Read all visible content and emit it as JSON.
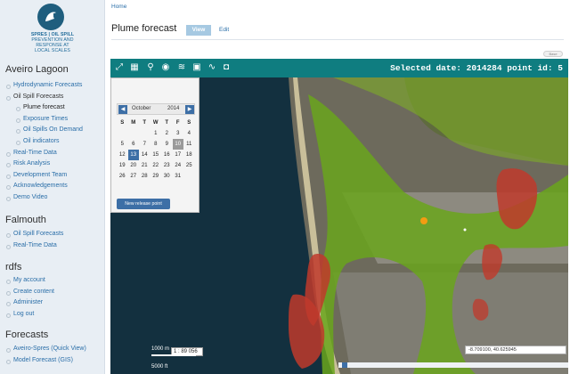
{
  "logo": {
    "line1": "SPRES | OIL SPILL",
    "line2": "PREVENTION AND",
    "line3": "RESPONSE AT",
    "line4": "LOCAL SCALES"
  },
  "sidebar": {
    "sections": [
      {
        "title": "Aveiro Lagoon",
        "items": [
          {
            "label": "Hydrodynamic Forecasts",
            "level": 1
          },
          {
            "label": "Oil Spill Forecasts",
            "level": 1
          },
          {
            "label": "Plume forecast",
            "level": 2
          },
          {
            "label": "Exposure Times",
            "level": 2
          },
          {
            "label": "Oil Spills On Demand",
            "level": 2
          },
          {
            "label": "Oil indicators",
            "level": 2
          },
          {
            "label": "Real-Time Data",
            "level": 1
          },
          {
            "label": "Risk Analysis",
            "level": 1
          },
          {
            "label": "Development Team",
            "level": 1
          },
          {
            "label": "Acknowledgements",
            "level": 1
          },
          {
            "label": "Demo Video",
            "level": 1
          }
        ]
      },
      {
        "title": "Falmouth",
        "items": [
          {
            "label": "Oil Spill Forecasts",
            "level": 1
          },
          {
            "label": "Real-Time Data",
            "level": 1
          }
        ]
      },
      {
        "title": "rdfs",
        "items": [
          {
            "label": "My account",
            "level": 1
          },
          {
            "label": "Create content",
            "level": 1
          },
          {
            "label": "Administer",
            "level": 1
          },
          {
            "label": "Log out",
            "level": 1
          }
        ]
      },
      {
        "title": "Forecasts",
        "items": [
          {
            "label": "Aveiro-Spres (Quick View)",
            "level": 1
          },
          {
            "label": "Model Forecast (GIS)",
            "level": 1
          }
        ]
      }
    ]
  },
  "breadcrumb": "Home",
  "page_title": "Plume forecast",
  "tabs": {
    "view": "View",
    "edit": "Edit"
  },
  "map": {
    "pill": "Base",
    "status": "Selected date: 2014284  point id: 5",
    "toolbar_icons": [
      "expand-icon",
      "calendar-icon",
      "search-icon",
      "target-icon",
      "wifi-icon",
      "download-icon",
      "waveform-icon",
      "camera-icon"
    ],
    "calendar": {
      "month": "October",
      "year": "2014",
      "prev": "◀",
      "next": "▶",
      "weekdays": [
        "S",
        "M",
        "T",
        "W",
        "T",
        "F",
        "S"
      ],
      "weeks": [
        [
          "",
          "",
          "",
          "1",
          "2",
          "3",
          "4"
        ],
        [
          "5",
          "6",
          "7",
          "8",
          "9",
          "10",
          "11"
        ],
        [
          "12",
          "13",
          "14",
          "15",
          "16",
          "17",
          "18"
        ],
        [
          "19",
          "20",
          "21",
          "22",
          "23",
          "24",
          "25"
        ],
        [
          "26",
          "27",
          "28",
          "29",
          "30",
          "31",
          ""
        ]
      ],
      "selected": "13",
      "today": "10",
      "button": "New release point"
    },
    "scale": {
      "top": "1000 m",
      "ratio": "1 : 89 056",
      "bottom": "5000 ft"
    },
    "coordinates": "-8.709100, 40.625945"
  },
  "colors": {
    "toolbar": "#0f7d80",
    "accent": "#3d6fa6",
    "plume_green": "#6aa51c",
    "plume_red": "#c0392b"
  }
}
